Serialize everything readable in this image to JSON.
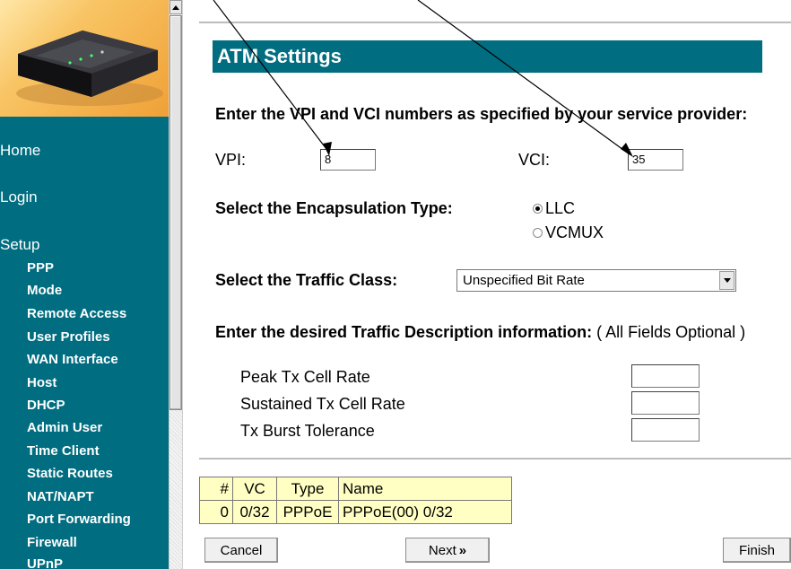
{
  "sidebar": {
    "major": [
      "Home",
      "Login",
      "Setup"
    ],
    "items": [
      "PPP",
      "Mode",
      "Remote Access",
      "User Profiles",
      "WAN Interface",
      "Host",
      "DHCP",
      "Admin User",
      "Time Client",
      "Static Routes",
      "NAT/NAPT",
      "Port Forwarding",
      "Firewall",
      "UPnP"
    ]
  },
  "page": {
    "title": "ATM Settings",
    "vpi_vci_heading": "Enter the VPI and VCI numbers as specified by your service provider:",
    "vpi_label": "VPI:",
    "vpi_value": "8",
    "vci_label": "VCI:",
    "vci_value": "35",
    "encapsulation_label": "Select the Encapsulation Type:",
    "encapsulation_options": [
      "LLC",
      "VCMUX"
    ],
    "encapsulation_selected": "LLC",
    "traffic_class_label": "Select the Traffic Class:",
    "traffic_class_value": "Unspecified Bit Rate",
    "traffic_desc_label": "Enter the desired Traffic Description information:",
    "traffic_desc_note": "( All Fields Optional )",
    "traffic_fields": [
      "Peak Tx Cell Rate",
      "Sustained Tx Cell Rate",
      "Tx Burst Tolerance"
    ]
  },
  "vc_table": {
    "headers": [
      "#",
      "VC",
      "Type",
      "Name"
    ],
    "rows": [
      [
        "0",
        "0/32",
        "PPPoE",
        "PPPoE(00) 0/32"
      ]
    ]
  },
  "buttons": {
    "cancel": "Cancel",
    "next": "Next",
    "next_glyph": "»",
    "finish": "Finish"
  },
  "colors": {
    "accent": "#006d80",
    "table_bg": "#ffffc4"
  }
}
